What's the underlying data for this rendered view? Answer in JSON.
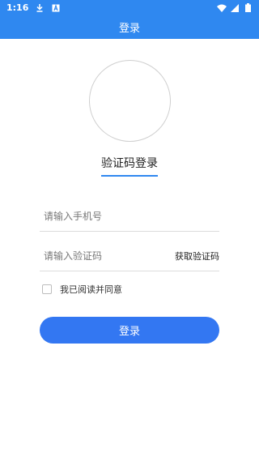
{
  "status_bar": {
    "time": "1:16",
    "left_icons": [
      "download-icon",
      "notification-a-icon"
    ],
    "right_icons": [
      "wifi-icon",
      "signal-icon",
      "battery-icon"
    ]
  },
  "app_bar": {
    "title": "登录"
  },
  "login": {
    "mode_title": "验证码登录",
    "phone_placeholder": "请输入手机号",
    "code_placeholder": "请输入验证码",
    "get_code_label": "获取验证码",
    "agree_text": "我已阅读并同意",
    "submit_label": "登录"
  },
  "colors": {
    "primary": "#2f88f0",
    "button": "#3377f2"
  }
}
